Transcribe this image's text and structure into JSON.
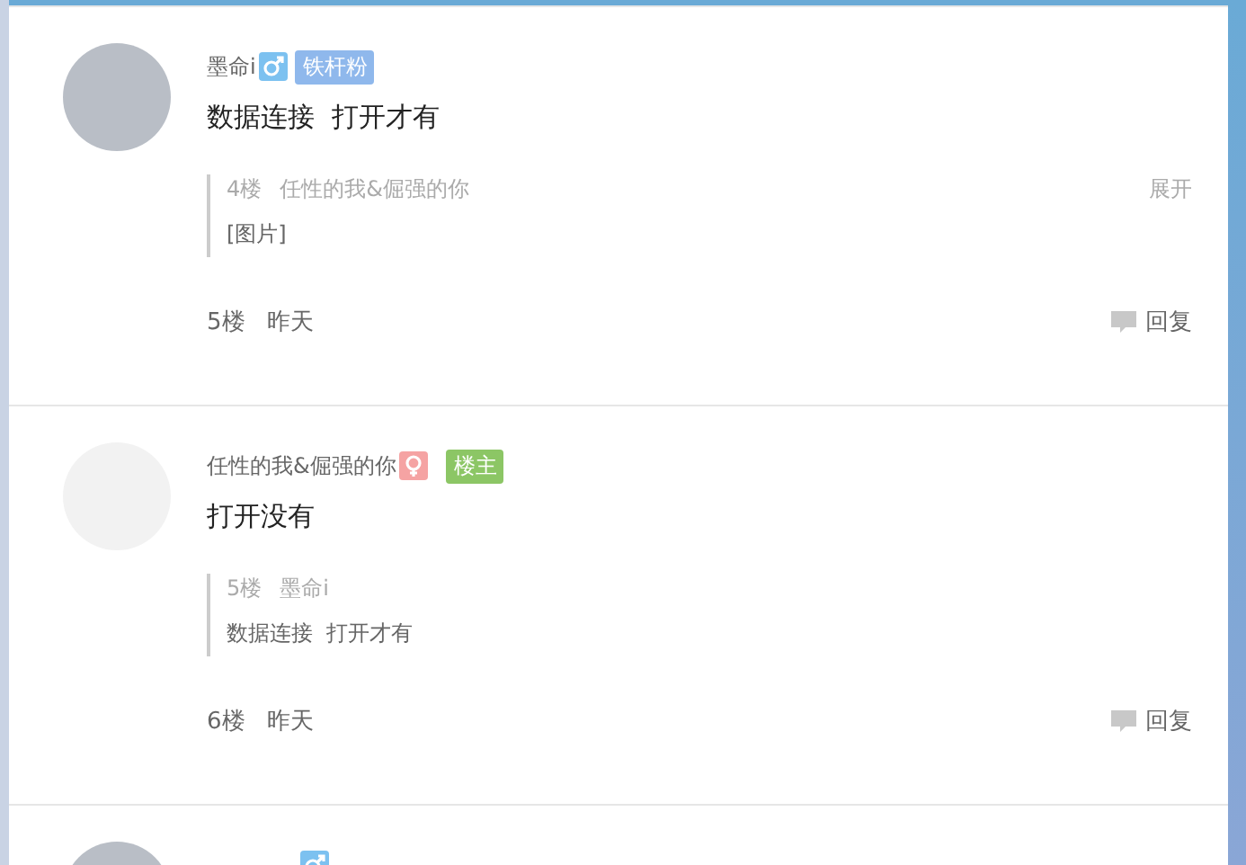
{
  "posts": [
    {
      "author": "墨命i",
      "gender_icon": {
        "kind": "male"
      },
      "badge": {
        "label": "铁杆粉",
        "color": "#8fb8ec"
      },
      "content": "数据连接  打开才有",
      "quote": {
        "floor": "4楼",
        "author": "任性的我&倔强的你",
        "text": "[图片]",
        "expand": "展开"
      },
      "floor": "5楼",
      "time": "昨天",
      "reply": "回复"
    },
    {
      "author": "任性的我&倔强的你",
      "gender_icon": {
        "kind": "female"
      },
      "badge": {
        "label": "楼主",
        "color": "#8cc665"
      },
      "content": "打开没有",
      "quote": {
        "floor": "5楼",
        "author": "墨命i",
        "text": "数据连接  打开才有"
      },
      "floor": "6楼",
      "time": "昨天",
      "reply": "回复"
    },
    {
      "gender_icon": {
        "kind": "male"
      }
    }
  ]
}
